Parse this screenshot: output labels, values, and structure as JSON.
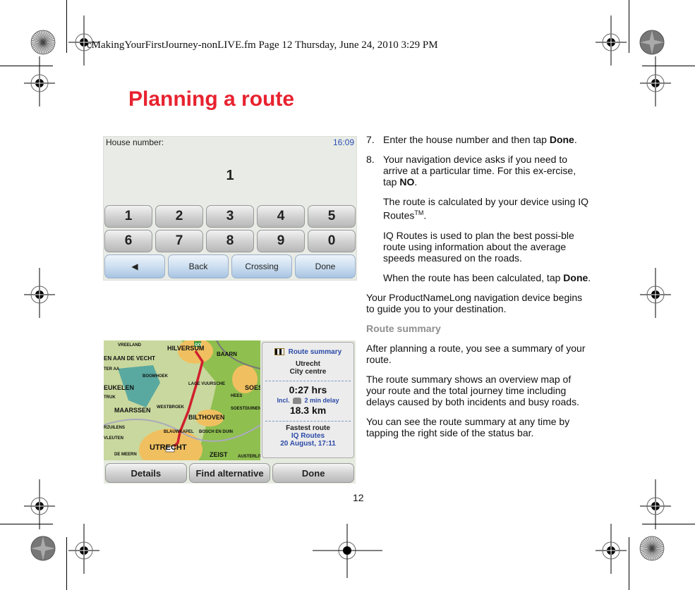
{
  "header": {
    "print_line": "cMakingYourFirstJourney-nonLIVE.fm  Page 12  Thursday, June 24, 2010  3:29 PM"
  },
  "page": {
    "title": "Planning a route",
    "number": "12"
  },
  "colors": {
    "title": "#e8222f",
    "device_blue": "#2b4aa8",
    "subheading_grey": "#8f8f8f"
  },
  "house_number_screen": {
    "label": "House number:",
    "time": "16:09",
    "entered_value": "1",
    "keypad_rows": [
      [
        "1",
        "2",
        "3",
        "4",
        "5"
      ],
      [
        "6",
        "7",
        "8",
        "9",
        "0"
      ]
    ],
    "bottom_buttons": {
      "backspace_icon": "◀",
      "back": "Back",
      "crossing": "Crossing",
      "done": "Done"
    }
  },
  "route_summary_screen": {
    "map_labels": [
      "VREELAND",
      "HILVERSUM",
      "EN AAN DE VECHT",
      "BAARN",
      "TER AA",
      "BOOMHOEK",
      "LAGE VUURSCHE",
      "EUKELEN",
      "SOES",
      "TRUK",
      "HEES",
      "WESTBROEK",
      "SOESTDUINEN",
      "MAARSSEN",
      "BILTHOVEN",
      "RZUILENS",
      "BLAUWKAPEL",
      "BOSCH EN DUIN",
      "VLEUTEN",
      "UTRECHT",
      "ZEIST",
      "DE MEERN",
      "AUSTERLITZ"
    ],
    "start_flag": "GO",
    "panel": {
      "title": "Route summary",
      "destination_line1": "Utrecht",
      "destination_line2": "City centre",
      "duration": "0:27 hrs",
      "delay_prefix": "Incl.",
      "delay": "2 min delay",
      "distance": "18.3 km",
      "route_type": "Fastest route",
      "routing": "IQ Routes",
      "date": "20 August, 17:11"
    },
    "buttons": {
      "details": "Details",
      "find_alternative": "Find alternative",
      "done": "Done"
    }
  },
  "content": {
    "steps": [
      {
        "num": "7.",
        "paragraphs": [
          {
            "text": "Enter the house number and then tap ",
            "bold": "Done",
            "after": "."
          }
        ]
      },
      {
        "num": "8.",
        "paragraphs": [
          {
            "text": "Your navigation device asks if you need to arrive at a particular time. For this ex-ercise, tap ",
            "bold": "NO",
            "after": "."
          },
          {
            "text": "The route is calculated by your device using IQ Routes",
            "sup": "TM",
            "after": "."
          },
          {
            "text": "IQ Routes is used to plan the best possi-ble route using information about the average speeds measured on the roads."
          },
          {
            "text": "When the route has been calculated, tap ",
            "bold": "Done",
            "after": "."
          }
        ]
      }
    ],
    "guide_paragraph": "Your ProductNameLong navigation device begins to guide you to your destination.",
    "subheading": "Route summary",
    "summary_paragraphs": [
      "After planning a route, you see a summary of your route.",
      "The route summary shows an overview map of your route and the total journey time including delays caused by both incidents and busy roads.",
      "You can see the route summary at any time by tapping the right side of the status bar."
    ]
  }
}
